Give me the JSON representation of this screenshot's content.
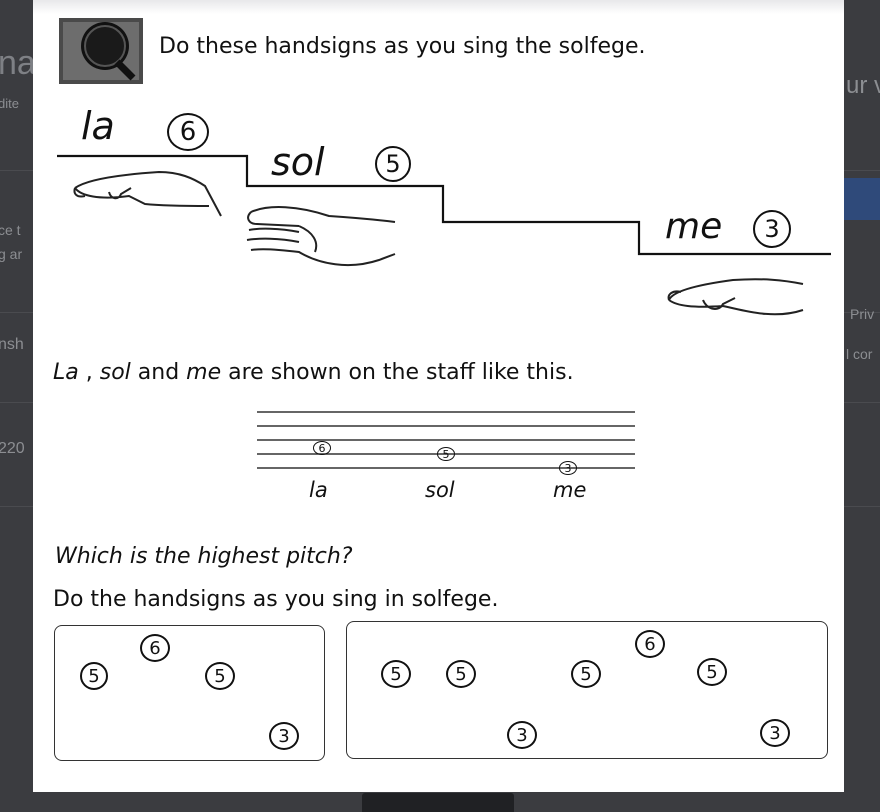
{
  "background": {
    "fragments": [
      "na",
      "dite",
      "ur v",
      "ce t",
      "g ar",
      "Priv",
      "nsh",
      "l cor",
      "220"
    ]
  },
  "worksheet": {
    "instruction": "Do these handsigns as you sing the solfege.",
    "steps": [
      {
        "syllable": "la",
        "number": "6"
      },
      {
        "syllable": "sol",
        "number": "5"
      },
      {
        "syllable": "me",
        "number": "3"
      }
    ],
    "staff_sentence": {
      "la": "La",
      "sep1": " , ",
      "sol": "sol",
      "and": " and ",
      "me": "me",
      "rest": " are shown on the staff like this."
    },
    "staff_notes": [
      {
        "number": "6",
        "label": "la"
      },
      {
        "number": "5",
        "label": "sol"
      },
      {
        "number": "3",
        "label": "me"
      }
    ],
    "question": "Which is the highest pitch?",
    "instruction2": "Do the handsigns as you sing in solfege.",
    "box1_notes": [
      "5",
      "6",
      "5",
      "3"
    ],
    "box2_notes": [
      "5",
      "5",
      "3",
      "5",
      "6",
      "5",
      "3"
    ]
  }
}
